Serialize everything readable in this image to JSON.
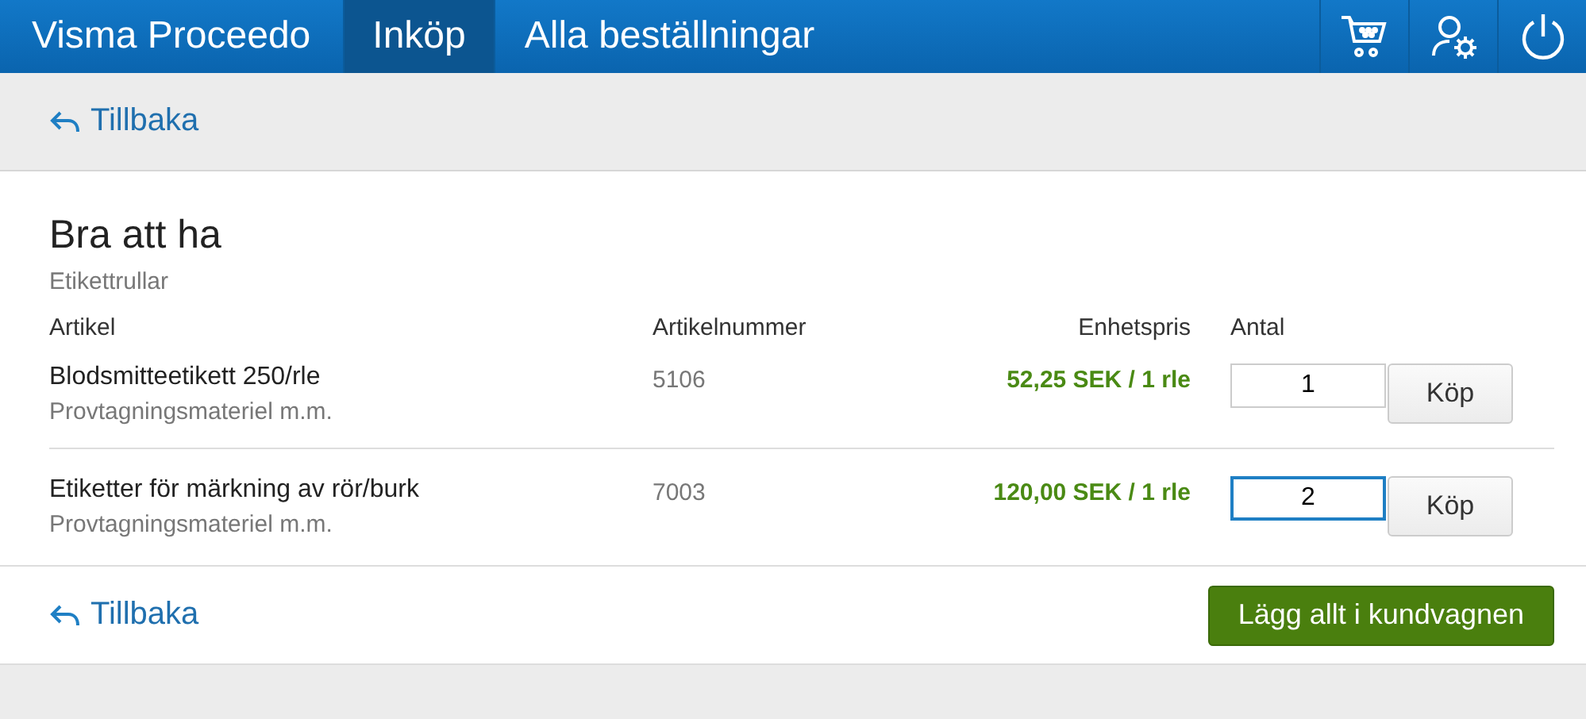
{
  "topbar": {
    "brand": "Visma Proceedo",
    "nav": [
      {
        "label": "Inköp",
        "selected": true
      },
      {
        "label": "Alla beställningar",
        "selected": false
      }
    ]
  },
  "back_top": "Tillbaka",
  "list": {
    "title": "Bra att ha",
    "subtitle": "Etikettrullar",
    "columns": [
      "Artikel",
      "Artikelnummer",
      "Enhetspris",
      "Antal"
    ],
    "rows": [
      {
        "name": "Blodsmitteetikett 250/rle",
        "category": "Provtagningsmateriel m.m.",
        "number": "5106",
        "price": "52,25 SEK / 1 rle",
        "quantity": "1",
        "focused": false,
        "button": "Köp"
      },
      {
        "name": "Etiketter för märkning av rör/burk",
        "category": "Provtagningsmateriel m.m.",
        "number": "7003",
        "price": "120,00 SEK / 1 rle",
        "quantity": "2",
        "focused": true,
        "button": "Köp"
      }
    ]
  },
  "back_bottom": "Tillbaka",
  "add_all_button": "Lägg allt i kundvagnen"
}
